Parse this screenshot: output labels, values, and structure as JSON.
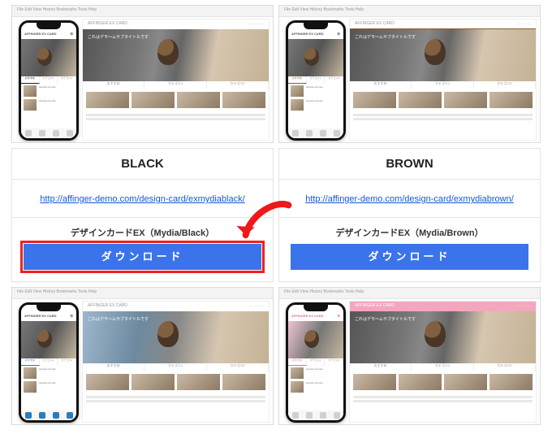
{
  "left": {
    "title": "BLACK",
    "demo_url": "http://affinger-demo.com/design-card/exmydiablack/",
    "pack_label": "デザインカードEX（Mydia/Black）",
    "download_label": "ダウンロード"
  },
  "right": {
    "title": "BROWN",
    "demo_url": "http://affinger-demo.com/design-card/exmydiabrown/",
    "pack_label": "デザインカードEX（Mydia/Brown）",
    "download_label": "ダウンロード"
  },
  "preview": {
    "site_brand": "AFFINGER EX CARD",
    "hero_caption": "これはデモ〜ムサブタイトルです",
    "tab1": "おすすめ",
    "tab2": "カテゴリ1",
    "tab3": "カテゴリ2"
  },
  "browser_menu": "File  Edit  View  History  Bookmarks  Tools  Help"
}
